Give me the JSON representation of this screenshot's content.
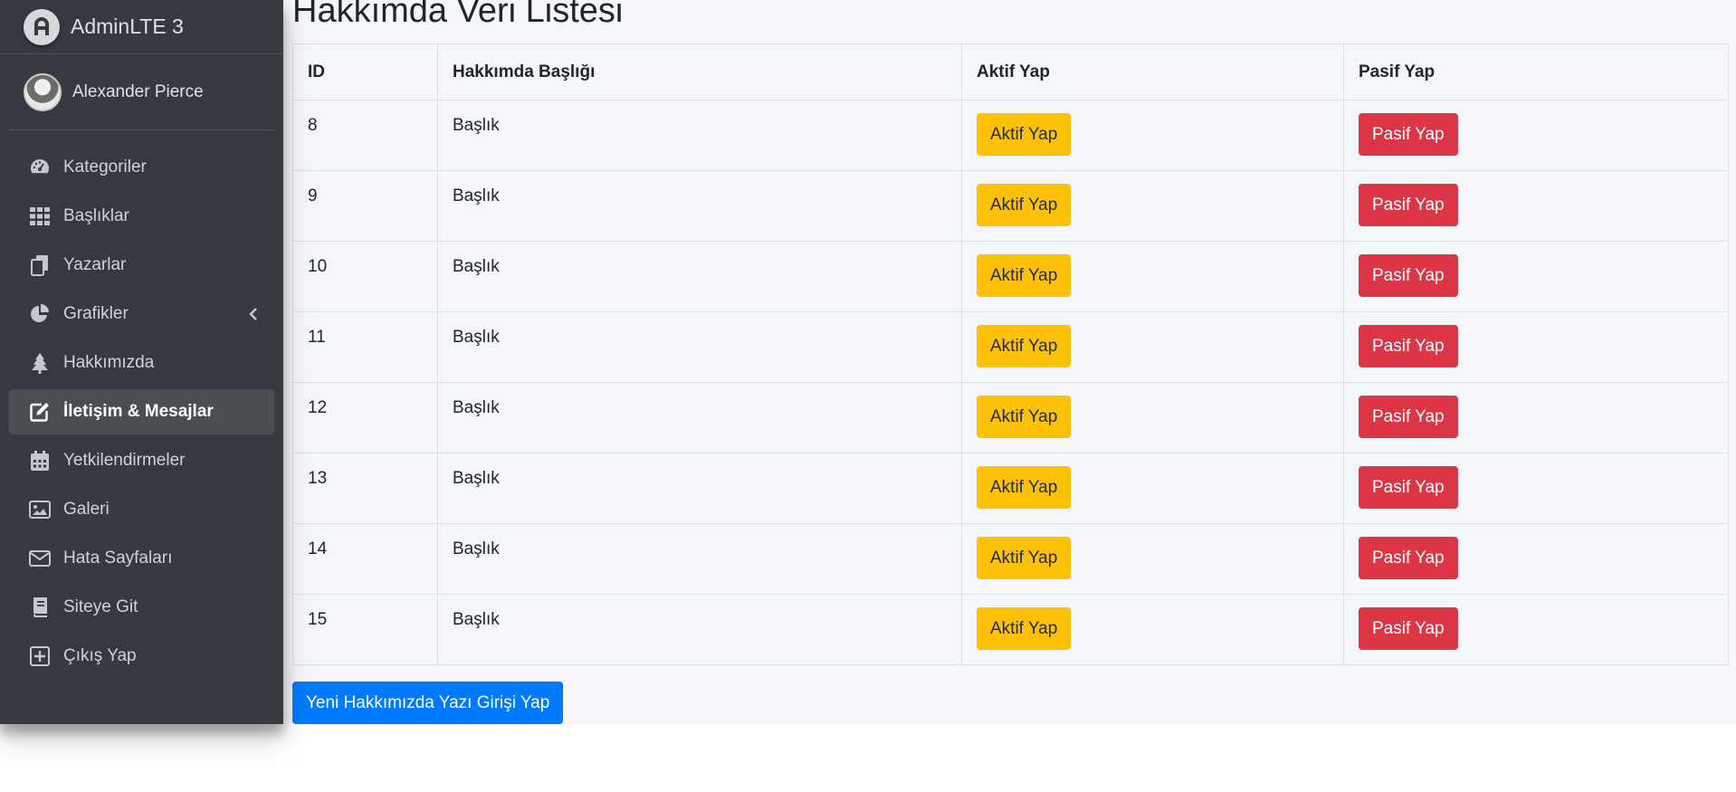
{
  "brand": {
    "name": "AdminLTE 3",
    "logo_icon": "adminlte-logo-icon"
  },
  "user": {
    "name": "Alexander Pierce"
  },
  "sidebar": {
    "items": [
      {
        "label": "Kategoriler",
        "icon": "tachometer-icon"
      },
      {
        "label": "Başlıklar",
        "icon": "grid-icon"
      },
      {
        "label": "Yazarlar",
        "icon": "copy-icon"
      },
      {
        "label": "Grafikler",
        "icon": "pie-chart-icon"
      },
      {
        "label": "Hakkımızda",
        "icon": "tree-icon"
      },
      {
        "label": "İletişim & Mesajlar",
        "icon": "edit-icon",
        "active": true
      },
      {
        "label": "Yetkilendirmeler",
        "icon": "calendar-icon"
      },
      {
        "label": "Galeri",
        "icon": "image-icon"
      },
      {
        "label": "Hata Sayfaları",
        "icon": "envelope-icon"
      },
      {
        "label": "Siteye Git",
        "icon": "book-icon"
      },
      {
        "label": "Çıkış Yap",
        "icon": "plus-square-icon"
      }
    ]
  },
  "page": {
    "title": "Hakkımda Veri Listesi"
  },
  "table": {
    "headers": [
      "ID",
      "Hakkımda Başlığı",
      "Aktif Yap",
      "Pasif Yap"
    ],
    "rows": [
      {
        "id": "8",
        "title": "Başlık",
        "activate": "Aktif Yap",
        "deactivate": "Pasif Yap"
      },
      {
        "id": "9",
        "title": "Başlık",
        "activate": "Aktif Yap",
        "deactivate": "Pasif Yap"
      },
      {
        "id": "10",
        "title": "Başlık",
        "activate": "Aktif Yap",
        "deactivate": "Pasif Yap"
      },
      {
        "id": "11",
        "title": "Başlık",
        "activate": "Aktif Yap",
        "deactivate": "Pasif Yap"
      },
      {
        "id": "12",
        "title": "Başlık",
        "activate": "Aktif Yap",
        "deactivate": "Pasif Yap"
      },
      {
        "id": "13",
        "title": "Başlık",
        "activate": "Aktif Yap",
        "deactivate": "Pasif Yap"
      },
      {
        "id": "14",
        "title": "Başlık",
        "activate": "Aktif Yap",
        "deactivate": "Pasif Yap"
      },
      {
        "id": "15",
        "title": "Başlık",
        "activate": "Aktif Yap",
        "deactivate": "Pasif Yap"
      }
    ]
  },
  "add_button": {
    "label": "Yeni Hakkımızda Yazı Girişi Yap"
  },
  "colors": {
    "sidebar": "#343a40",
    "warning": "#ffc107",
    "danger": "#dc3545",
    "primary": "#007bff",
    "content_bg": "#f4f6f9"
  }
}
